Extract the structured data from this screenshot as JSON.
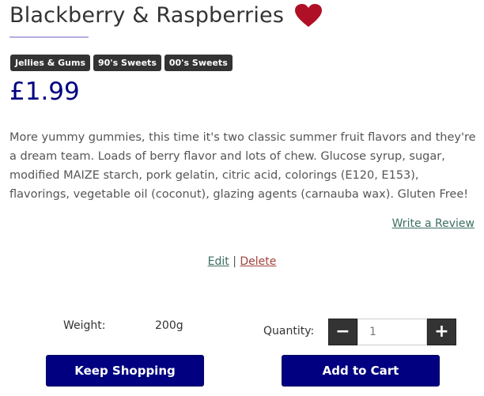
{
  "product": {
    "title": "Blackberry & Raspberries",
    "price": "£1.99",
    "description": "More yummy gummies, this time it's two classic summer fruit flavors and they're a dream team. Loads of berry flavor and lots of chew. Glucose syrup, sugar, modified MAIZE starch, pork gelatin, citric acid, colorings (E120, E153), flavorings, vegetable oil (coconut), glazing agents (carnauba wax). Gluten Free!",
    "favorite_icon": "heart-icon",
    "favorite_color": "#b01025",
    "tags": [
      {
        "label": "Jellies & Gums"
      },
      {
        "label": "90's Sweets"
      },
      {
        "label": "00's Sweets"
      }
    ],
    "weight_label": "Weight:",
    "weight_value": "200g"
  },
  "links": {
    "write_review": "Write a Review",
    "edit": "Edit",
    "separator": "|",
    "delete": "Delete"
  },
  "quantity": {
    "label": "Quantity:",
    "value": "1",
    "minus_symbol": "−",
    "plus_symbol": "+"
  },
  "buttons": {
    "keep_shopping": "Keep Shopping",
    "add_to_cart": "Add to Cart"
  },
  "colors": {
    "accent": "#000080",
    "tag_background": "#333333",
    "link": "#3c6e63",
    "delete_link": "#a0423c"
  }
}
